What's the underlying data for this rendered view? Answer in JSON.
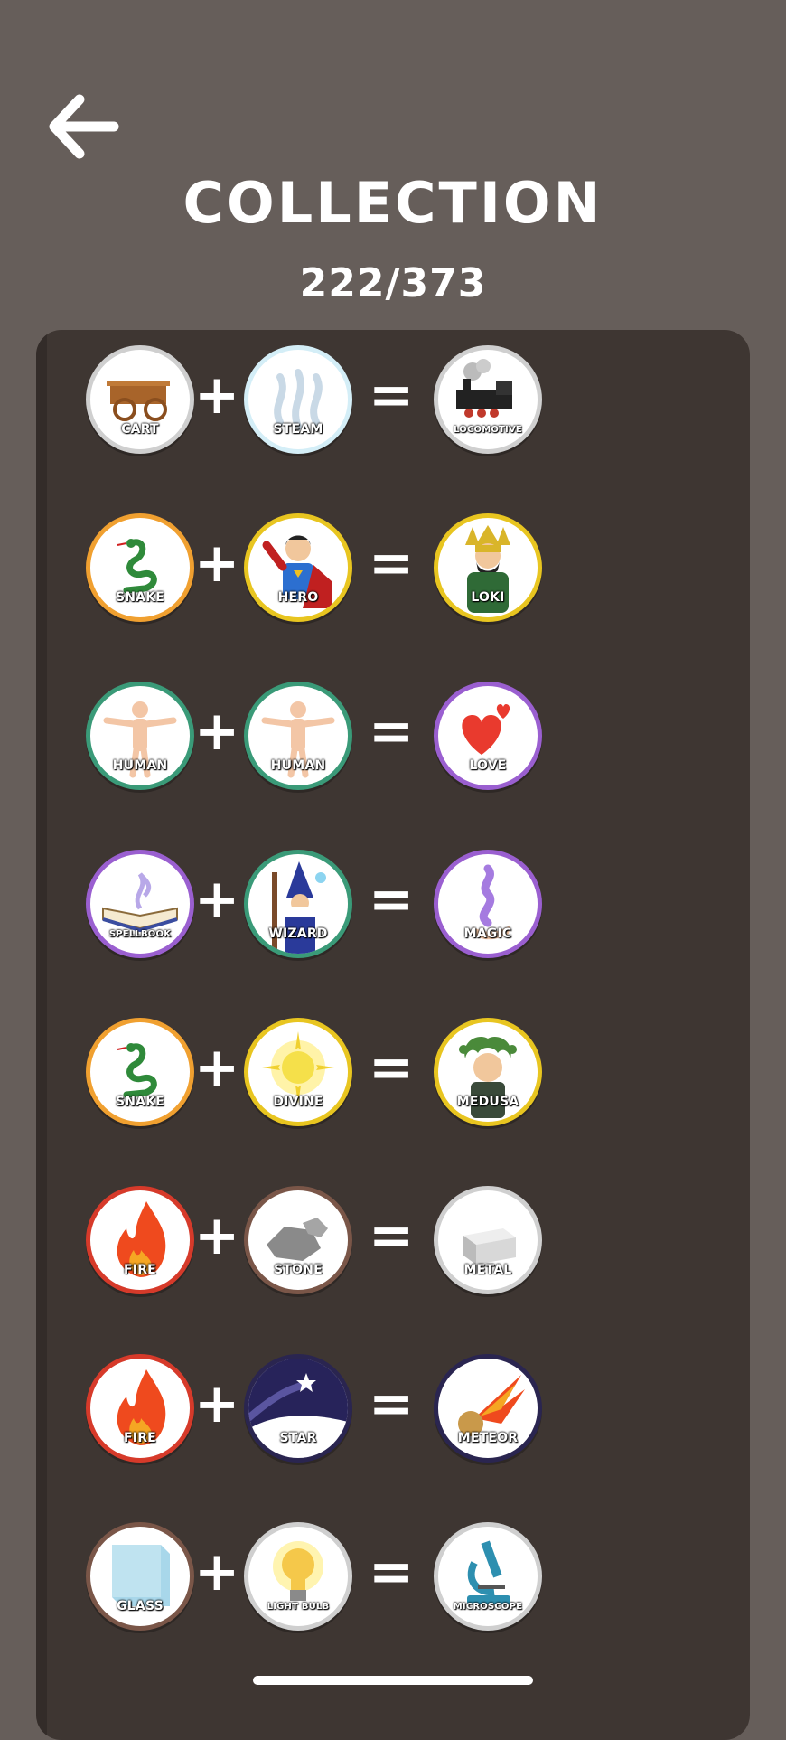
{
  "header": {
    "title": "COLLECTION",
    "progress": "222/373",
    "back_icon": "arrow-left-icon"
  },
  "recipes": [
    {
      "a": {
        "label": "CART",
        "icon": "cart-icon",
        "ring": "#cfcfcf"
      },
      "b": {
        "label": "STEAM",
        "icon": "steam-icon",
        "ring": "#d4eef7"
      },
      "result": {
        "label": "LOCOMOTIVE",
        "icon": "locomotive-icon",
        "ring": "#cfcfcf"
      }
    },
    {
      "a": {
        "label": "SNAKE",
        "icon": "snake-icon",
        "ring": "#f0a030"
      },
      "b": {
        "label": "HERO",
        "icon": "hero-icon",
        "ring": "#e8c520"
      },
      "result": {
        "label": "LOKI",
        "icon": "loki-icon",
        "ring": "#e8c520"
      }
    },
    {
      "a": {
        "label": "HUMAN",
        "icon": "human-icon",
        "ring": "#3a9a78"
      },
      "b": {
        "label": "HUMAN",
        "icon": "human-icon",
        "ring": "#3a9a78"
      },
      "result": {
        "label": "LOVE",
        "icon": "heart-icon",
        "ring": "#9a5fd0"
      }
    },
    {
      "a": {
        "label": "SPELLBOOK",
        "icon": "spellbook-icon",
        "ring": "#9a5fd0"
      },
      "b": {
        "label": "WIZARD",
        "icon": "wizard-icon",
        "ring": "#3a9a78"
      },
      "result": {
        "label": "MAGIC",
        "icon": "magic-icon",
        "ring": "#9a5fd0"
      }
    },
    {
      "a": {
        "label": "SNAKE",
        "icon": "snake-icon",
        "ring": "#f0a030"
      },
      "b": {
        "label": "DIVINE",
        "icon": "divine-icon",
        "ring": "#e8c520"
      },
      "result": {
        "label": "MEDUSA",
        "icon": "medusa-icon",
        "ring": "#e8c520"
      }
    },
    {
      "a": {
        "label": "FIRE",
        "icon": "fire-icon",
        "ring": "#d63a2a"
      },
      "b": {
        "label": "STONE",
        "icon": "stone-icon",
        "ring": "#7a5648"
      },
      "result": {
        "label": "METAL",
        "icon": "metal-icon",
        "ring": "#cfcfcf"
      }
    },
    {
      "a": {
        "label": "FIRE",
        "icon": "fire-icon",
        "ring": "#d63a2a"
      },
      "b": {
        "label": "STAR",
        "icon": "star-icon",
        "ring": "#2a2550"
      },
      "result": {
        "label": "METEOR",
        "icon": "meteor-icon",
        "ring": "#2a2550"
      }
    },
    {
      "a": {
        "label": "GLASS",
        "icon": "glass-icon",
        "ring": "#7a5648"
      },
      "b": {
        "label": "LIGHT BULB",
        "icon": "light-bulb-icon",
        "ring": "#cfcfcf"
      },
      "result": {
        "label": "MICROSCOPE",
        "icon": "microscope-icon",
        "ring": "#cfcfcf"
      }
    }
  ],
  "operators": {
    "plus": "+",
    "equals": "="
  }
}
